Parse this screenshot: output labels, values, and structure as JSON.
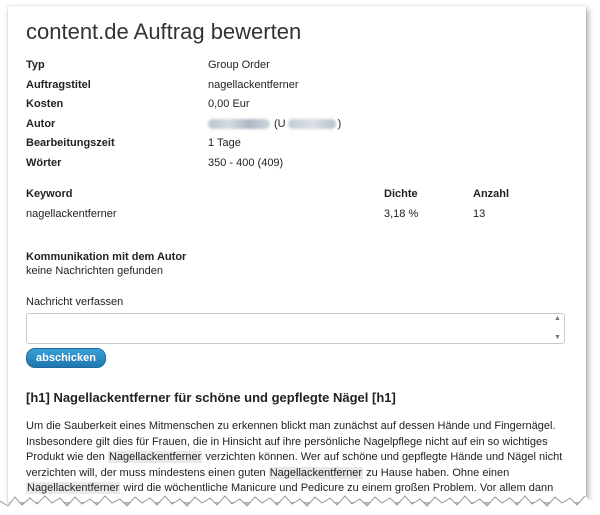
{
  "page": {
    "title": "content.de Auftrag bewerten"
  },
  "info": [
    {
      "label": "Typ",
      "value": "Group Order"
    },
    {
      "label": "Auftragstitel",
      "value": "nagellackentferner"
    },
    {
      "label": "Kosten",
      "value": "0,00 Eur"
    },
    {
      "label": "Autor",
      "value": "(U"
    },
    {
      "label": "Bearbeitungszeit",
      "value": "1 Tage"
    },
    {
      "label": "Wörter",
      "value": "350 - 400 (409)"
    }
  ],
  "keywords": {
    "headers": [
      "Keyword",
      "Dichte",
      "Anzahl"
    ],
    "rows": [
      [
        "nagellackentferner",
        "3,18 %",
        "13"
      ]
    ]
  },
  "communication": {
    "heading": "Kommunikation mit dem Autor",
    "text": "keine Nachrichten gefunden"
  },
  "message_form": {
    "label": "Nachricht verfassen",
    "value": "",
    "submit_label": "abschicken"
  },
  "article": {
    "heading": "[h1] Nagellackentferner für schöne und gepflegte Nägel [h1]",
    "p1": "Um die Sauberkeit eines Mitmenschen zu erkennen blickt man zunächst auf dessen Hände und Fingernägel. Insbesondere gilt dies für Frauen, die in Hinsicht auf ihre persönliche Nagelpflege nicht auf ein so wichtiges Produkt wie den ",
    "kw1": "Nagellackentferner",
    "p2": " verzichten können. Wer auf schöne und gepflegte Hände und Nägel nicht verzichten will, der muss mindestens einen guten ",
    "kw2": "Nagellackentferner",
    "p3": " zu Hause haben. Ohne einen ",
    "kw3": "Nagellackentferner",
    "p4": " wird die wöchentliche Manicure und Pedicure zu einem großen Problem. Vor allem dann"
  }
}
